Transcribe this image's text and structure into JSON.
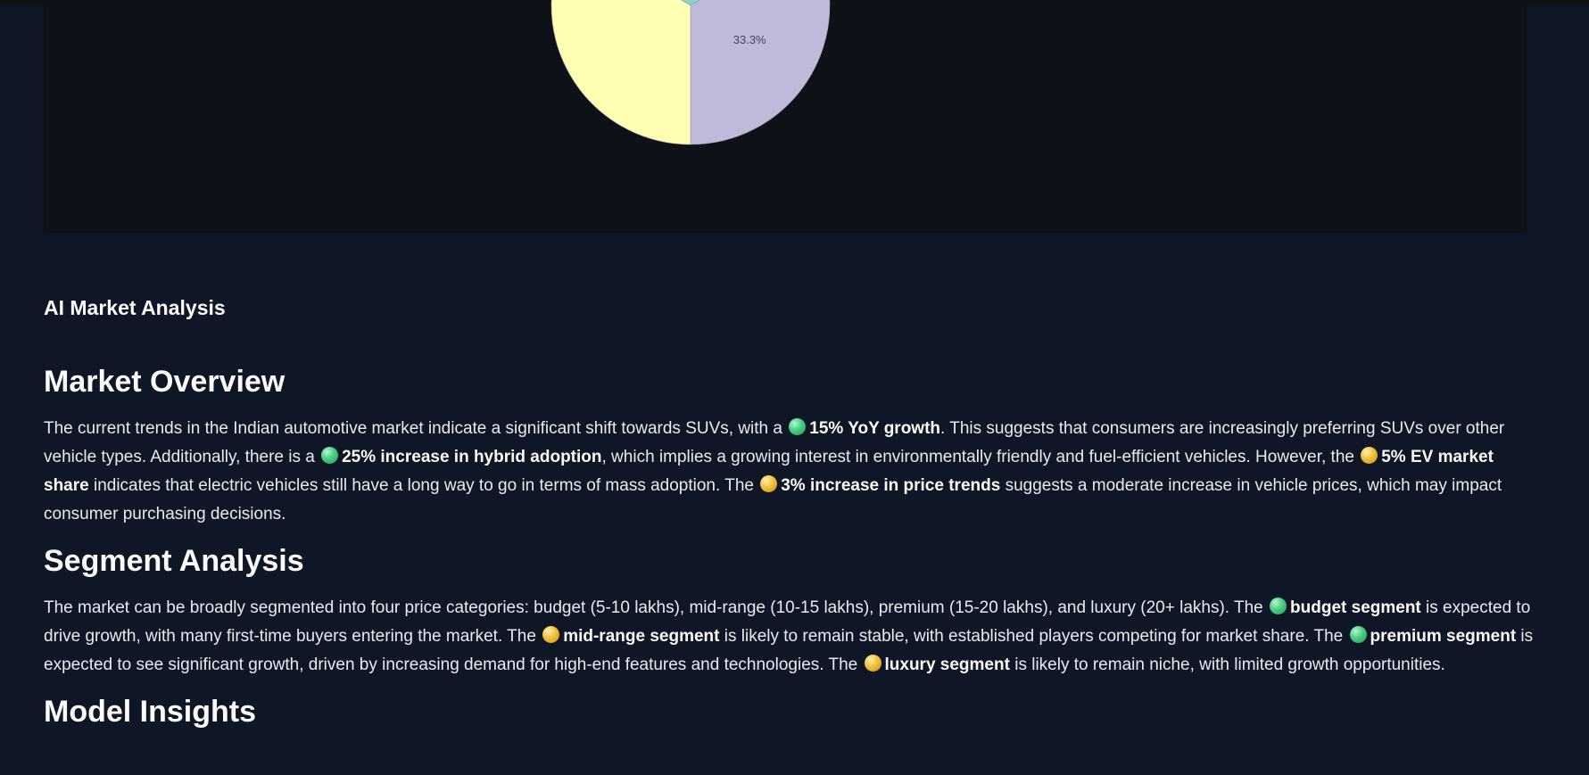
{
  "chart_data": {
    "type": "pie",
    "visible_labels": [
      "33.3%"
    ],
    "slices": [
      {
        "value": 33.3,
        "label": "33.3%",
        "color": "#bebada"
      },
      {
        "value": 33.3,
        "label": "",
        "color": "#8dd3c7"
      },
      {
        "value": 33.3,
        "label": "",
        "color": "#ffffb3"
      }
    ]
  },
  "colors": {
    "page_bg": "#0f1727",
    "panel_bg": "#0e1117",
    "positive": "#4fd18a",
    "neutral": "#f4c542"
  },
  "ai_heading": "AI Market Analysis",
  "sections": [
    {
      "title": "Market Overview",
      "segments": [
        {
          "t": "text",
          "v": "The current trends in the Indian automotive market indicate a significant shift towards SUVs, with a "
        },
        {
          "t": "dot",
          "v": "green"
        },
        {
          "t": "bold",
          "v": "15% YoY growth"
        },
        {
          "t": "text",
          "v": ". This suggests that consumers are increasingly preferring SUVs over other vehicle types. Additionally, there is a "
        },
        {
          "t": "dot",
          "v": "green"
        },
        {
          "t": "bold",
          "v": "25% increase in hybrid adoption"
        },
        {
          "t": "text",
          "v": ", which implies a growing interest in environmentally friendly and fuel-efficient vehicles. However, the "
        },
        {
          "t": "dot",
          "v": "yellow"
        },
        {
          "t": "bold",
          "v": "5% EV market share"
        },
        {
          "t": "text",
          "v": " indicates that electric vehicles still have a long way to go in terms of mass adoption. The "
        },
        {
          "t": "dot",
          "v": "yellow"
        },
        {
          "t": "bold",
          "v": "3% increase in price trends"
        },
        {
          "t": "text",
          "v": " suggests a moderate increase in vehicle prices, which may impact consumer purchasing decisions."
        }
      ]
    },
    {
      "title": "Segment Analysis",
      "segments": [
        {
          "t": "text",
          "v": "The market can be broadly segmented into four price categories: budget (5-10 lakhs), mid-range (10-15 lakhs), premium (15-20 lakhs), and luxury (20+ lakhs). The "
        },
        {
          "t": "dot",
          "v": "green"
        },
        {
          "t": "bold",
          "v": "budget segment"
        },
        {
          "t": "text",
          "v": " is expected to drive growth, with many first-time buyers entering the market. The "
        },
        {
          "t": "dot",
          "v": "yellow"
        },
        {
          "t": "bold",
          "v": "mid-range segment"
        },
        {
          "t": "text",
          "v": " is likely to remain stable, with established players competing for market share. The "
        },
        {
          "t": "dot",
          "v": "green"
        },
        {
          "t": "bold",
          "v": "premium segment"
        },
        {
          "t": "text",
          "v": " is expected to see significant growth, driven by increasing demand for high-end features and technologies. The "
        },
        {
          "t": "dot",
          "v": "yellow"
        },
        {
          "t": "bold",
          "v": "luxury segment"
        },
        {
          "t": "text",
          "v": " is likely to remain niche, with limited growth opportunities."
        }
      ]
    },
    {
      "title": "Model Insights",
      "segments": []
    }
  ]
}
